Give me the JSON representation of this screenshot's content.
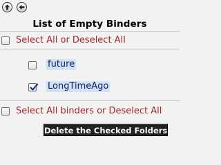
{
  "header": {
    "up_icon": "up-arrow-icon",
    "back_icon": "left-arrow-icon",
    "title": "List of Empty Binders"
  },
  "top_select": {
    "label": "Select All or Deselect All",
    "checked": false
  },
  "binders": [
    {
      "name": "future",
      "checked": false
    },
    {
      "name": "LongTimeAgo",
      "checked": true
    }
  ],
  "bottom_select": {
    "label": "Select All binders or Deselect All",
    "checked": false
  },
  "actions": {
    "delete_label": "Delete the Checked Folders"
  },
  "colors": {
    "link": "#a4262c",
    "highlight": "#cfe3f5",
    "button_bg": "#222222",
    "check": "#1c3f8c"
  }
}
